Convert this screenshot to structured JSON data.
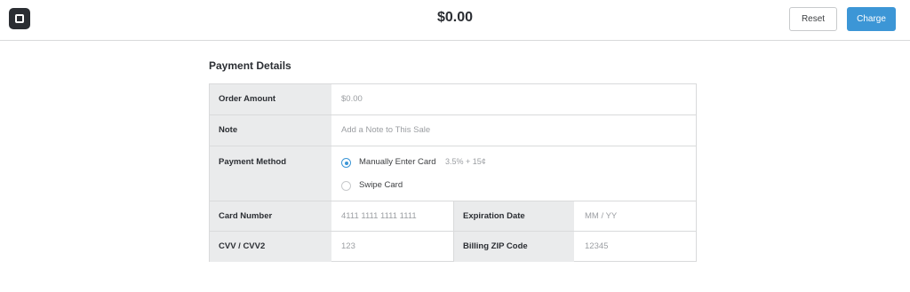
{
  "header": {
    "total": "$0.00",
    "reset_label": "Reset",
    "charge_label": "Charge"
  },
  "form": {
    "title": "Payment Details",
    "order_amount": {
      "label": "Order Amount",
      "placeholder": "$0.00"
    },
    "note": {
      "label": "Note",
      "placeholder": "Add a Note to This Sale"
    },
    "payment_method": {
      "label": "Payment Method",
      "options": [
        {
          "label": "Manually Enter Card",
          "fee": "3.5% + 15¢",
          "selected": true
        },
        {
          "label": "Swipe Card",
          "fee": "",
          "selected": false
        }
      ]
    },
    "card_number": {
      "label": "Card Number",
      "placeholder": "4111 1111 1111 1111"
    },
    "expiration": {
      "label": "Expiration Date",
      "placeholder": "MM / YY"
    },
    "cvv": {
      "label": "CVV / CVV2",
      "placeholder": "123"
    },
    "zip": {
      "label": "Billing ZIP Code",
      "placeholder": "12345"
    }
  },
  "colors": {
    "accent": "#3c96d6",
    "label_background": "#eaebec",
    "border": "#d9dadb"
  }
}
